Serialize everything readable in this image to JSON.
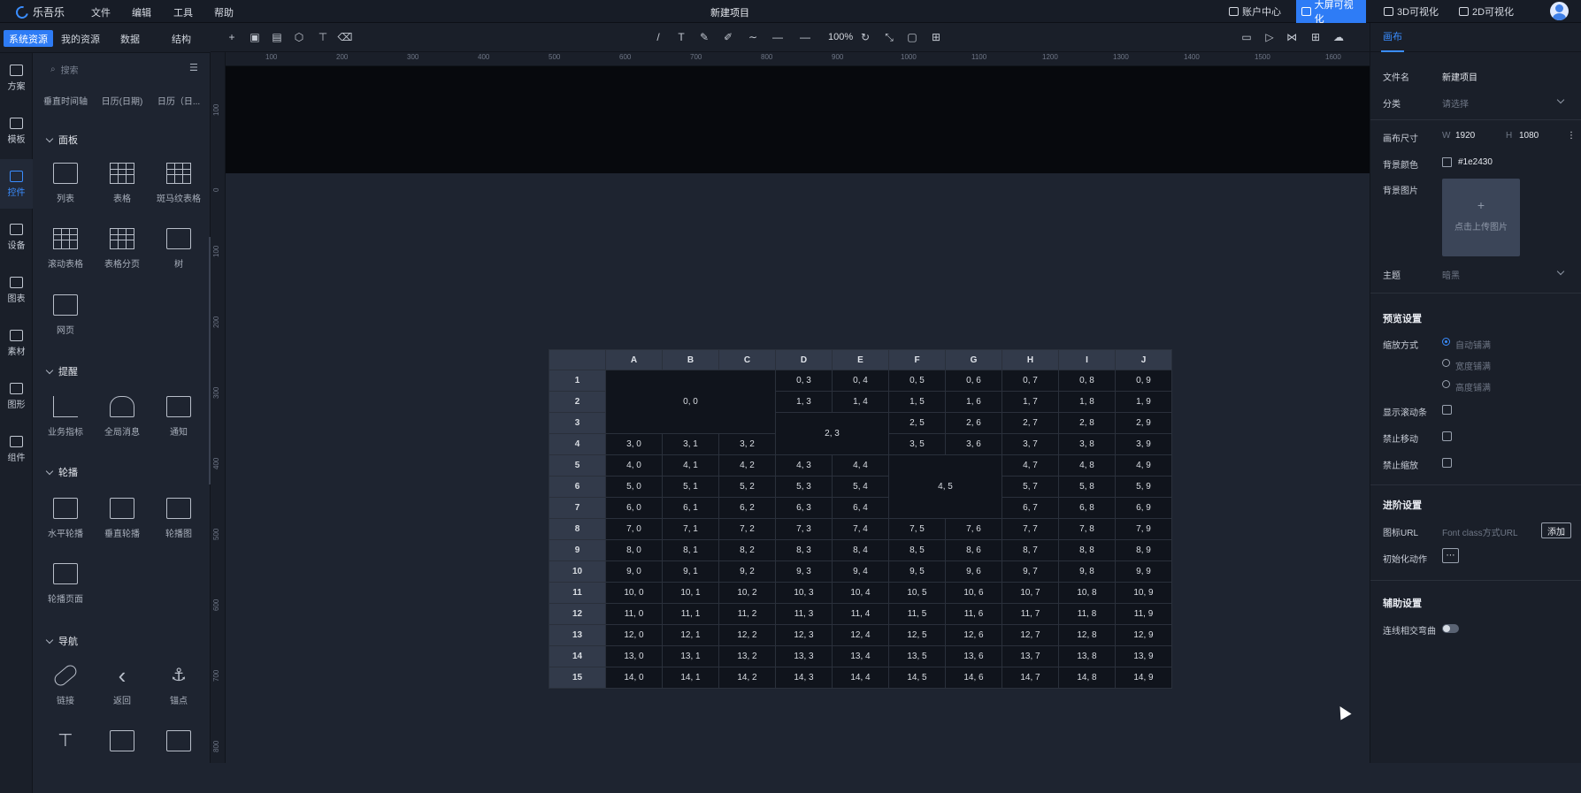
{
  "app": {
    "logo_text": "乐吾乐",
    "project_title": "新建项目"
  },
  "menu": [
    "文件",
    "编辑",
    "工具",
    "帮助"
  ],
  "topnav": [
    {
      "label": "账户中心",
      "icon": "home-icon",
      "active": false
    },
    {
      "label": "大屏可视化",
      "icon": "monitor-icon",
      "active": true
    },
    {
      "label": "3D可视化",
      "icon": "cube-icon",
      "active": false
    },
    {
      "label": "2D可视化",
      "icon": "grid-icon",
      "active": false
    }
  ],
  "left_tabs": [
    "系统资源",
    "我的资源",
    "数据",
    "结构"
  ],
  "rail": [
    {
      "label": "方案",
      "icon": "monitor-icon",
      "active": false
    },
    {
      "label": "模板",
      "icon": "template-icon",
      "active": false
    },
    {
      "label": "控件",
      "icon": "controls-icon",
      "active": true
    },
    {
      "label": "设备",
      "icon": "cube-icon",
      "active": false
    },
    {
      "label": "图表",
      "icon": "chart-icon",
      "active": false
    },
    {
      "label": "素材",
      "icon": "image-icon",
      "active": false
    },
    {
      "label": "图形",
      "icon": "shapes-icon",
      "active": false
    },
    {
      "label": "组件",
      "icon": "component-icon",
      "active": false
    }
  ],
  "panel": {
    "search_placeholder": "搜索",
    "cut_row": [
      "垂直时间轴",
      "日历(日期)",
      "日历（日..."
    ],
    "sections": [
      {
        "title": "面板",
        "items": [
          "列表",
          "表格",
          "斑马纹表格",
          "滚动表格",
          "表格分页",
          "树",
          "网页"
        ]
      },
      {
        "title": "提醒",
        "items": [
          "业务指标",
          "全局消息",
          "通知"
        ]
      },
      {
        "title": "轮播",
        "items": [
          "水平轮播",
          "垂直轮播",
          "轮播图",
          "轮播页面"
        ]
      },
      {
        "title": "导航",
        "items": [
          "链接",
          "返回",
          "锚点"
        ]
      }
    ]
  },
  "toolbar": {
    "zoom": "100%"
  },
  "ruler_h": [
    "100",
    "200",
    "300",
    "400",
    "500",
    "600",
    "700",
    "800",
    "900",
    "1000",
    "1100",
    "1200",
    "1300",
    "1400",
    "1500",
    "1600"
  ],
  "ruler_v": [
    "100",
    "0",
    "100",
    "200",
    "300",
    "400",
    "500",
    "600",
    "700",
    "800"
  ],
  "grid": {
    "columns": [
      "A",
      "B",
      "C",
      "D",
      "E",
      "F",
      "G",
      "H",
      "I",
      "J"
    ],
    "merged": {
      "r0c0": "0, 0",
      "r2c3": "2, 3",
      "r4c5": "4, 5"
    }
  },
  "right_panel": {
    "tab": "画布",
    "file_name_label": "文件名",
    "file_name": "新建项目",
    "category_label": "分类",
    "category_placeholder": "请选择",
    "canvas_size_label": "画布尺寸",
    "w_label": "W",
    "width": "1920",
    "h_label": "H",
    "height": "1080",
    "bg_color_label": "背景颜色",
    "bg_color": "#1e2430",
    "bg_image_label": "背景图片",
    "upload_hint": "点击上传图片",
    "theme_label": "主题",
    "theme_value": "暗黑",
    "preview_title": "预览设置",
    "scale_label": "缩放方式",
    "scale_options": [
      "自动铺满",
      "宽度铺满",
      "高度铺满"
    ],
    "scale_selected": 0,
    "show_scrollbar": "显示滚动条",
    "no_move": "禁止移动",
    "no_zoom": "禁止缩放",
    "advanced_title": "进阶设置",
    "icon_url_label": "图标URL",
    "icon_url_placeholder": "Font class方式URL",
    "add_button": "添加",
    "init_action_label": "初始化动作",
    "aux_title": "辅助设置",
    "line_curve_label": "连线相交弯曲"
  }
}
